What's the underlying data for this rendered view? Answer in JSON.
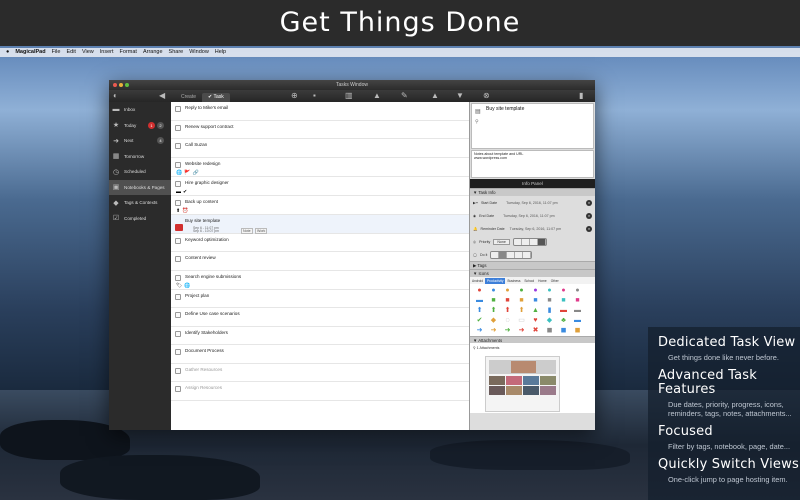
{
  "headline": "Get Things Done",
  "menubar": [
    "MagicalPad",
    "File",
    "Edit",
    "View",
    "Insert",
    "Format",
    "Arrange",
    "Share",
    "Window",
    "Help"
  ],
  "window": {
    "title": "Tasks Window",
    "tabs": [
      "Create",
      "Task"
    ]
  },
  "sidebar": {
    "items": [
      {
        "label": "Inbox",
        "icon": "inbox-icon",
        "glyph": "▬"
      },
      {
        "label": "Today",
        "icon": "star-icon",
        "glyph": "★",
        "badges": [
          {
            "text": "1",
            "color": "#d12f2f"
          },
          {
            "text": "2",
            "color": "#555"
          }
        ]
      },
      {
        "label": "Next",
        "icon": "next-icon",
        "glyph": "➜",
        "badges": [
          {
            "text": "4",
            "color": "#555"
          }
        ]
      },
      {
        "label": "Tomorrow",
        "icon": "calendar-icon",
        "glyph": "▦"
      },
      {
        "label": "Scheduled",
        "icon": "clock-icon",
        "glyph": "◷"
      },
      {
        "label": "Notebooks & Pages",
        "icon": "notebook-icon",
        "glyph": "▣"
      },
      {
        "label": "Tags & Contexts",
        "icon": "tag-icon",
        "glyph": "◆"
      },
      {
        "label": "Completed",
        "icon": "check-icon",
        "glyph": "☑"
      }
    ]
  },
  "tasks": [
    {
      "title": "Reply to Mike's email"
    },
    {
      "title": "Renew support contract"
    },
    {
      "title": "Call Suzan"
    },
    {
      "title": "Website redesign",
      "icons": [
        "🌐",
        "🚩",
        "🔗"
      ]
    },
    {
      "title": "Hire graphic designer",
      "icons": [
        "▬",
        "✔"
      ]
    },
    {
      "title": "Back up content",
      "icons": [
        "⬆",
        "⏰"
      ]
    },
    {
      "title": "Buy site template",
      "meta": [
        "Sep 6 - 11:07 pm",
        "Sep 6 - 10:07 pm"
      ],
      "chips": [
        "Note",
        "Work"
      ]
    },
    {
      "title": "Keyword optimization"
    },
    {
      "title": "Content review"
    },
    {
      "title": "Search engine submissions",
      "icons": [
        "🏷",
        "🌐"
      ]
    },
    {
      "title": "Project plan"
    },
    {
      "title": "Define Use case scenarios"
    },
    {
      "title": "Identify Stakeholders"
    },
    {
      "title": "Document Process"
    },
    {
      "title": "Gather Resources",
      "dim": true
    },
    {
      "title": "Assign Resources",
      "dim": true
    }
  ],
  "panel": {
    "note_title": "Buy site template",
    "note_text": "Notes about template and URL",
    "note_url": "www.wordpress.com",
    "title": "Info Panel",
    "task_info": "Task Info",
    "start_label": "Start Date",
    "start_value": "Tuesday, Sep 6, 2016, 11:07 pm",
    "end_label": "End Date",
    "end_value": "Tuesday, Sep 6, 2016, 11:07 pm",
    "reminder_label": "Reminder Date",
    "reminder_value": "Tuesday, Sep 6, 2016, 11:07 pm",
    "priority_label": "Priority",
    "priority_value": "None",
    "done_label": "Do it",
    "tags": "Tags",
    "icons": "Icons",
    "icon_tabs": [
      "Android",
      "Productivity",
      "Business",
      "School",
      "Home",
      "Other"
    ],
    "attachments": "Attachments",
    "attach_count": "1 Attachments"
  },
  "features": [
    {
      "title": "Dedicated Task View",
      "desc": "Get things done like never before."
    },
    {
      "title": "Advanced Task Features",
      "desc": "Due dates, priority, progress, icons, reminders, tags, notes, attachments..."
    },
    {
      "title": "Focused",
      "desc": "Filter by tags, notebook, page, date..."
    },
    {
      "title": "Quickly Switch Views",
      "desc": "One-click jump to page hosting item."
    }
  ],
  "colors": {
    "accent": "#3d7fd9",
    "badge_red": "#d12f2f",
    "sidebar": "#2b2b2b"
  }
}
